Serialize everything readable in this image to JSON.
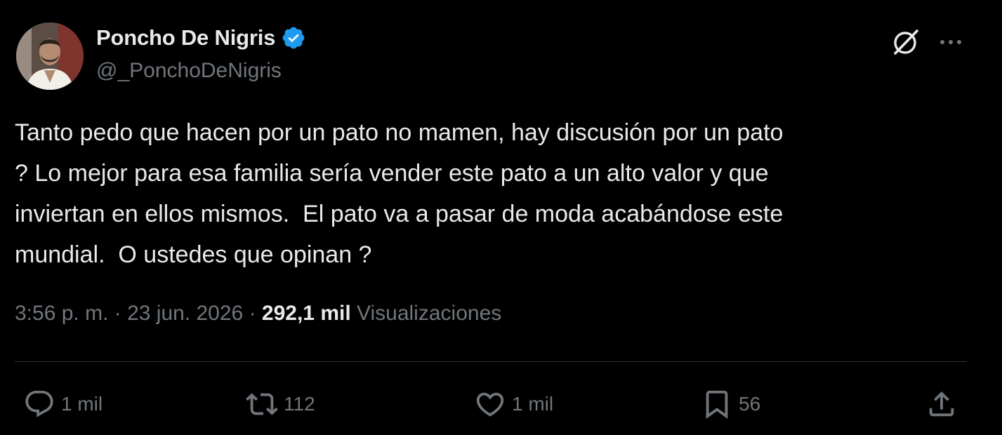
{
  "user": {
    "display_name": "Poncho De Nigris",
    "handle": "@_PonchoDeNigris",
    "verified": true
  },
  "tweet": {
    "text": "Tanto pedo que hacen por un pato no mamen, hay discusión por un pato\n? Lo mejor para esa familia sería vender este pato a un alto valor y que\ninviertan en ellos mismos.  El pato va a pasar de moda acabándose este\nmundial.  O ustedes que opinan ?",
    "time": "3:56 p. m.",
    "separator": " · ",
    "date": "23 jun. 2026",
    "views_count": "292,1 mil",
    "views_label": "Visualizaciones"
  },
  "actions": {
    "replies": "1 mil",
    "retweets": "112",
    "likes": "1 mil",
    "bookmarks": "56"
  },
  "icons": {
    "header": [
      "grok-icon",
      "more-icon"
    ],
    "actions": [
      "reply-icon",
      "retweet-icon",
      "like-icon",
      "bookmark-icon",
      "share-icon"
    ]
  },
  "colors": {
    "background": "#000000",
    "primary_text": "#e7e9ea",
    "secondary_text": "#71767b",
    "verified_badge": "#1d9bf0",
    "divider": "#2f3336"
  }
}
